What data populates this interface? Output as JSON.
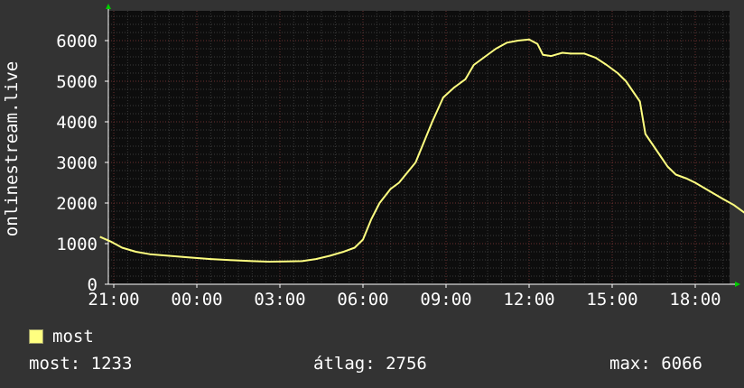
{
  "chart_data": {
    "type": "line",
    "ylabel": "onlinestream.live",
    "ylim": [
      0,
      6000
    ],
    "yticks": [
      0,
      1000,
      2000,
      3000,
      4000,
      5000,
      6000
    ],
    "xticks": [
      {
        "label": "21:00",
        "hour": 21
      },
      {
        "label": "00:00",
        "hour": 24
      },
      {
        "label": "03:00",
        "hour": 27
      },
      {
        "label": "06:00",
        "hour": 30
      },
      {
        "label": "09:00",
        "hour": 33
      },
      {
        "label": "12:00",
        "hour": 36
      },
      {
        "label": "15:00",
        "hour": 39
      },
      {
        "label": "18:00",
        "hour": 42
      }
    ],
    "x_range_hours": [
      20.5,
      44.5
    ],
    "grid": true,
    "series": [
      {
        "name": "most",
        "color": "#ffff80",
        "points": [
          [
            20.5,
            1170
          ],
          [
            20.9,
            1050
          ],
          [
            21.3,
            900
          ],
          [
            21.8,
            800
          ],
          [
            22.3,
            740
          ],
          [
            23.0,
            700
          ],
          [
            23.7,
            660
          ],
          [
            24.5,
            620
          ],
          [
            25.3,
            590
          ],
          [
            26.0,
            570
          ],
          [
            26.6,
            555
          ],
          [
            27.2,
            560
          ],
          [
            27.8,
            570
          ],
          [
            28.3,
            620
          ],
          [
            28.8,
            700
          ],
          [
            29.3,
            800
          ],
          [
            29.7,
            900
          ],
          [
            30.0,
            1100
          ],
          [
            30.3,
            1600
          ],
          [
            30.6,
            2000
          ],
          [
            31.0,
            2350
          ],
          [
            31.3,
            2500
          ],
          [
            31.6,
            2750
          ],
          [
            31.9,
            3000
          ],
          [
            32.2,
            3500
          ],
          [
            32.5,
            4000
          ],
          [
            32.7,
            4300
          ],
          [
            32.9,
            4600
          ],
          [
            33.3,
            4850
          ],
          [
            33.7,
            5050
          ],
          [
            34.0,
            5400
          ],
          [
            34.4,
            5600
          ],
          [
            34.8,
            5800
          ],
          [
            35.2,
            5950
          ],
          [
            35.6,
            6000
          ],
          [
            36.0,
            6030
          ],
          [
            36.3,
            5920
          ],
          [
            36.5,
            5650
          ],
          [
            36.8,
            5620
          ],
          [
            37.2,
            5700
          ],
          [
            37.5,
            5680
          ],
          [
            38.0,
            5680
          ],
          [
            38.4,
            5580
          ],
          [
            38.8,
            5400
          ],
          [
            39.2,
            5200
          ],
          [
            39.5,
            5000
          ],
          [
            39.8,
            4700
          ],
          [
            40.0,
            4500
          ],
          [
            40.2,
            3700
          ],
          [
            40.5,
            3400
          ],
          [
            40.8,
            3100
          ],
          [
            41.0,
            2900
          ],
          [
            41.3,
            2700
          ],
          [
            41.7,
            2600
          ],
          [
            42.0,
            2500
          ],
          [
            42.5,
            2300
          ],
          [
            43.0,
            2100
          ],
          [
            43.4,
            1950
          ],
          [
            43.8,
            1750
          ],
          [
            44.2,
            1550
          ],
          [
            44.5,
            1300
          ],
          [
            44.6,
            1233
          ]
        ]
      }
    ]
  },
  "legend": {
    "label": "most"
  },
  "stats": {
    "current": "most: 1233",
    "average": "átlag: 2756",
    "max": "max: 6066"
  }
}
